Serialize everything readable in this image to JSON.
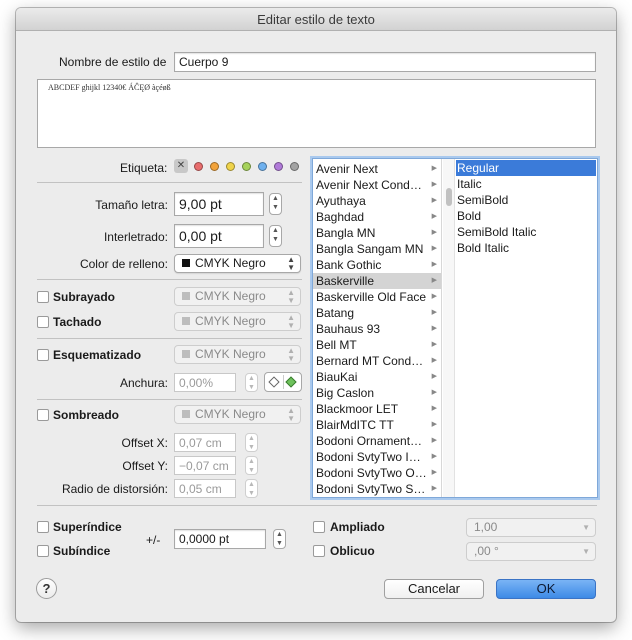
{
  "window": {
    "title": "Editar estilo de texto"
  },
  "name_label": "Nombre de estilo de",
  "name_value": "Cuerpo 9",
  "preview_text": "ABCDEF ghijkl 12340€ ÁĈĘØ àçéøß",
  "etiqueta": {
    "label": "Etiqueta:",
    "clear_symbol": "✕",
    "colors": [
      "#e86d6d",
      "#f2a33b",
      "#efd34a",
      "#a6d25b",
      "#6fb1ee",
      "#b07ad8",
      "#a3a3a3"
    ]
  },
  "size": {
    "label": "Tamaño letra:",
    "value": "9,00 pt"
  },
  "leading": {
    "label": "Interletrado:",
    "value": "0,00 pt"
  },
  "fill": {
    "label": "Color de relleno:",
    "value": "CMYK Negro",
    "swatch_color": "#111111"
  },
  "underline": {
    "label": "Subrayado",
    "value": "CMYK Negro"
  },
  "strike": {
    "label": "Tachado",
    "value": "CMYK Negro"
  },
  "outline": {
    "label": "Esquematizado",
    "value": "CMYK Negro",
    "width_label": "Anchura:",
    "width_value": "0,00%"
  },
  "shadow": {
    "label": "Sombreado",
    "value": "CMYK Negro",
    "offset_x_label": "Offset X:",
    "offset_x_value": "0,07 cm",
    "offset_y_label": "Offset Y:",
    "offset_y_value": "−0,07 cm",
    "radius_label": "Radio de distorsión:",
    "radius_value": "0,05 cm"
  },
  "fonts": [
    "Avenir Next",
    "Avenir Next Cond…",
    "Ayuthaya",
    "Baghdad",
    "Bangla MN",
    "Bangla Sangam MN",
    "Bank Gothic",
    "Baskerville",
    "Baskerville Old Face",
    "Batang",
    "Bauhaus 93",
    "Bell MT",
    "Bernard MT Cond…",
    "BiauKai",
    "Big Caslon",
    "Blackmoor LET",
    "BlairMdITC TT",
    "Bodoni Ornament…",
    "Bodoni SvtyTwo I…",
    "Bodoni SvtyTwo O…",
    "Bodoni SvtyTwo S…"
  ],
  "selected_font": "Baskerville",
  "styles": [
    "Regular",
    "Italic",
    "SemiBold",
    "Bold",
    "SemiBold Italic",
    "Bold Italic"
  ],
  "selected_style": "Regular",
  "superscript": {
    "label": "Superíndice"
  },
  "subscript": {
    "label": "Subíndice"
  },
  "plusminus": {
    "label": "+/-",
    "value": "0,0000 pt"
  },
  "expanded": {
    "label": "Ampliado",
    "value": "1,00"
  },
  "oblique": {
    "label": "Oblicuo",
    "value": ",00 °"
  },
  "buttons": {
    "help": "?",
    "cancel": "Cancelar",
    "ok": "OK"
  },
  "icons": {
    "arrow_right": "▶",
    "arrow_up": "▲",
    "arrow_down": "▼"
  }
}
